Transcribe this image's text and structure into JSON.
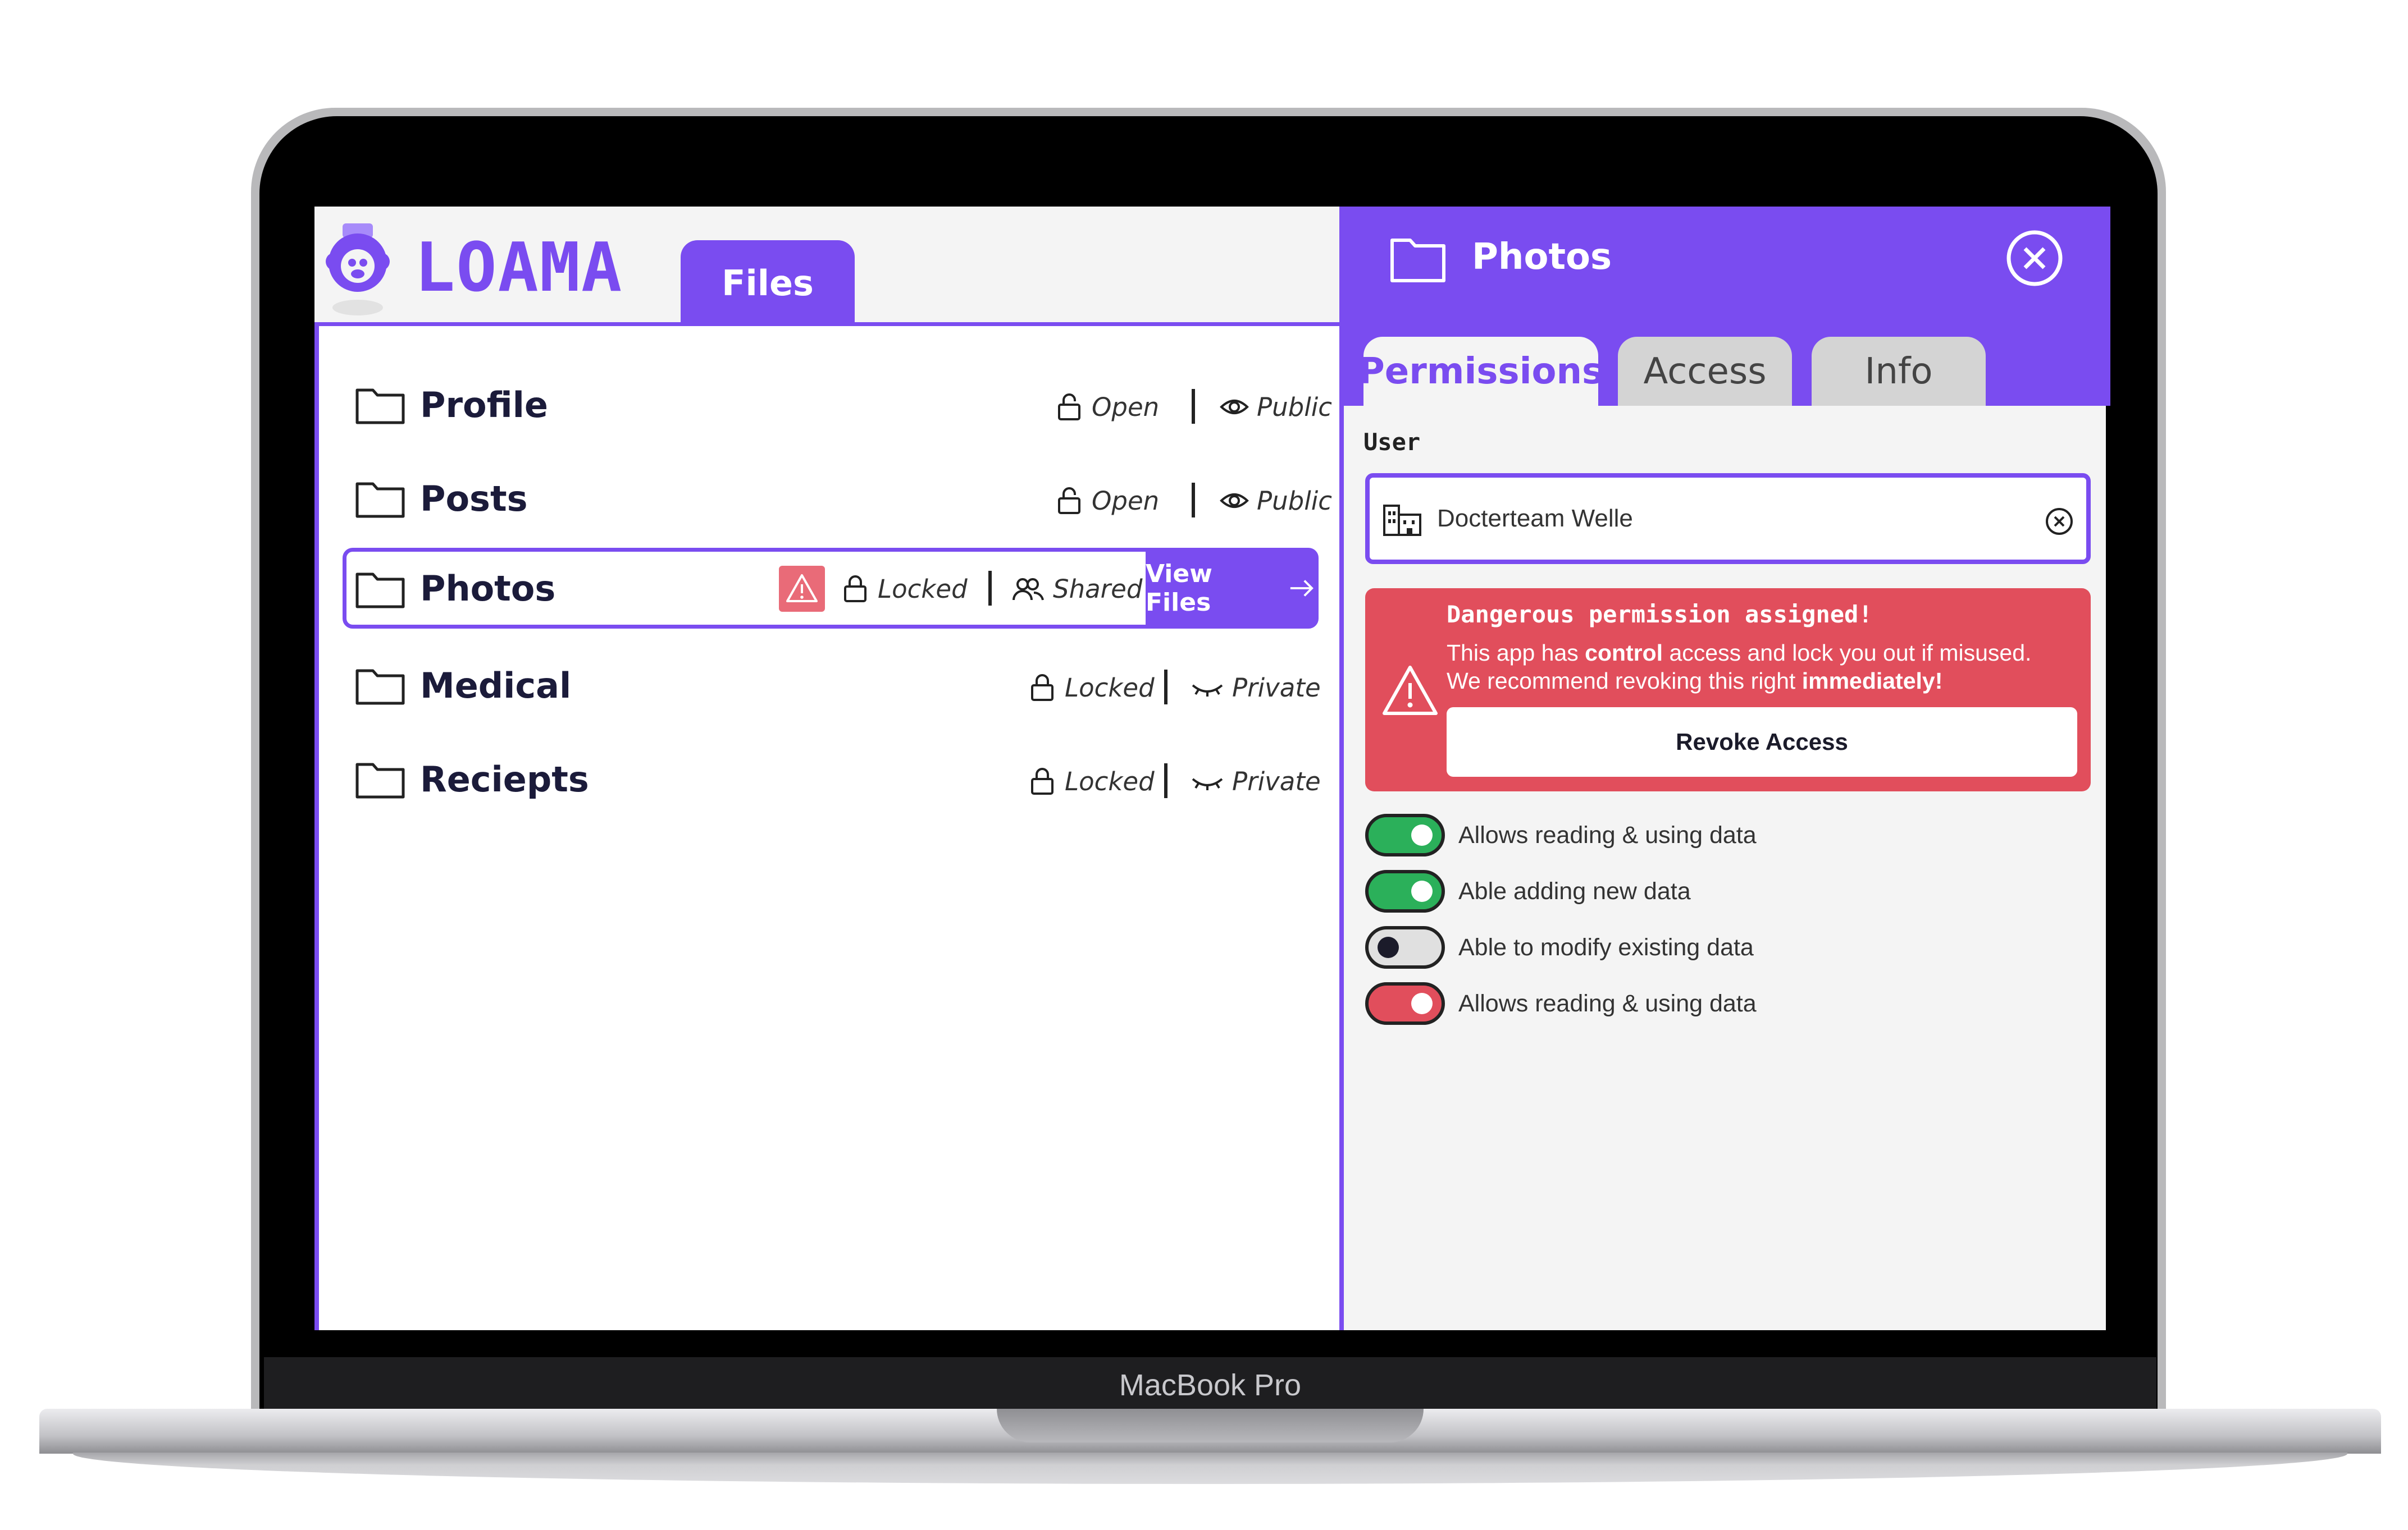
{
  "device": {
    "brand_label": "MacBook Pro"
  },
  "app": {
    "logo_text": "LOAMA",
    "nav_tab": "Files",
    "accent_color": "#7a4cf0",
    "danger_color": "#e14e5c"
  },
  "folders": [
    {
      "name": "Profile",
      "lock_icon": "open-lock-icon",
      "lock": "Open",
      "visibility_icon": "eye-icon",
      "visibility": "Public"
    },
    {
      "name": "Posts",
      "lock_icon": "open-lock-icon",
      "lock": "Open",
      "visibility_icon": "eye-icon",
      "visibility": "Public"
    },
    {
      "name": "Photos",
      "lock_icon": "lock-icon",
      "lock": "Locked",
      "visibility_icon": "users-icon",
      "visibility": "Shared",
      "warning": true,
      "action": "View Files"
    },
    {
      "name": "Medical",
      "lock_icon": "lock-icon",
      "lock": "Locked",
      "visibility_icon": "closed-eye-icon",
      "visibility": "Private"
    },
    {
      "name": "Reciepts",
      "lock_icon": "lock-icon",
      "lock": "Locked",
      "visibility_icon": "closed-eye-icon",
      "visibility": "Private"
    }
  ],
  "panel": {
    "title": "Photos",
    "tabs": [
      "Permissions",
      "Access",
      "Info"
    ],
    "active_tab": "Permissions",
    "user_label": "User",
    "user_value": "Docterteam Welle",
    "warning": {
      "title": "Dangerous permission assigned!",
      "line1_pre": "This app has ",
      "line1_bold": "control",
      "line1_post": " access and lock you out if misused.",
      "line2_pre": "We recommend revoking this right ",
      "line2_bold": "immediately!",
      "button": "Revoke Access"
    },
    "permissions": [
      {
        "label": "Allows reading & using data",
        "state": "on",
        "color": "#2bb05a"
      },
      {
        "label": "Able adding new data",
        "state": "on",
        "color": "#2bb05a"
      },
      {
        "label": "Able to modify existing data",
        "state": "off",
        "color": "#e0e0e0"
      },
      {
        "label": "Allows reading & using data",
        "state": "on",
        "color": "#e14e5c"
      }
    ]
  }
}
